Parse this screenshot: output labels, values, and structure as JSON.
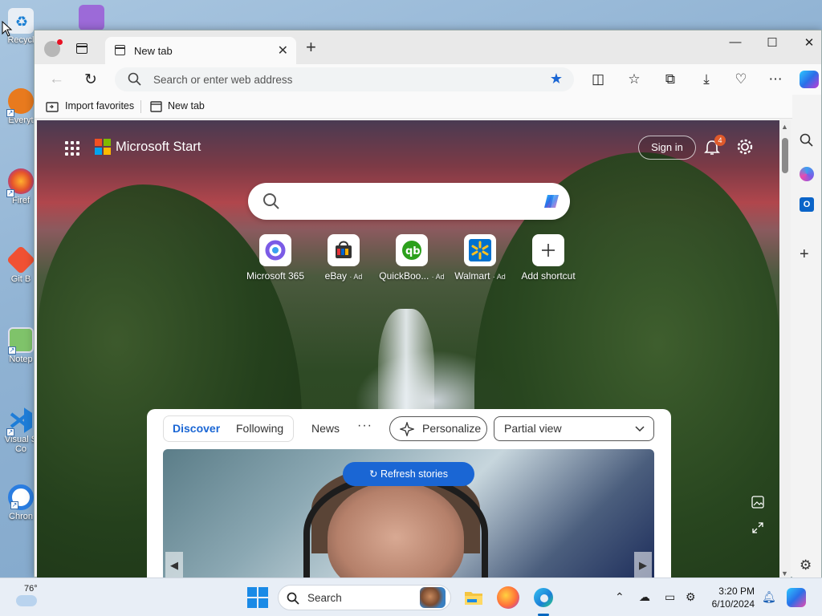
{
  "desktop": {
    "icons": [
      {
        "label": "Recycl",
        "name": "recycle-bin"
      },
      {
        "label": "Everyt",
        "name": "everything"
      },
      {
        "label": "Firef",
        "name": "firefox"
      },
      {
        "label": "Git B",
        "name": "git-bash"
      },
      {
        "label": "Notep",
        "name": "notepad"
      },
      {
        "label": "Visual S Co",
        "name": "visual-studio-code"
      },
      {
        "label": "Chron",
        "name": "chrome"
      }
    ]
  },
  "browser": {
    "tab_title": "New tab",
    "address_placeholder": "Search or enter web address",
    "favorites": {
      "import": "Import favorites",
      "new_tab": "New tab"
    }
  },
  "page": {
    "brand": "Microsoft Start",
    "sign_in": "Sign in",
    "notification_count": "4",
    "shortcuts": [
      {
        "label": "Microsoft 365",
        "ad": ""
      },
      {
        "label": "eBay",
        "ad": "· Ad"
      },
      {
        "label": "QuickBoo...",
        "ad": "· Ad"
      },
      {
        "label": "Walmart",
        "ad": "· Ad"
      },
      {
        "label": "Add shortcut",
        "ad": ""
      }
    ],
    "feed": {
      "tabs": [
        "Discover",
        "Following",
        "News"
      ],
      "more": "···",
      "personalize": "Personalize",
      "view_select": "Partial view",
      "refresh": "Refresh stories"
    }
  },
  "taskbar": {
    "temperature": "76°",
    "search": "Search",
    "time": "3:20 PM",
    "date": "6/10/2024"
  }
}
